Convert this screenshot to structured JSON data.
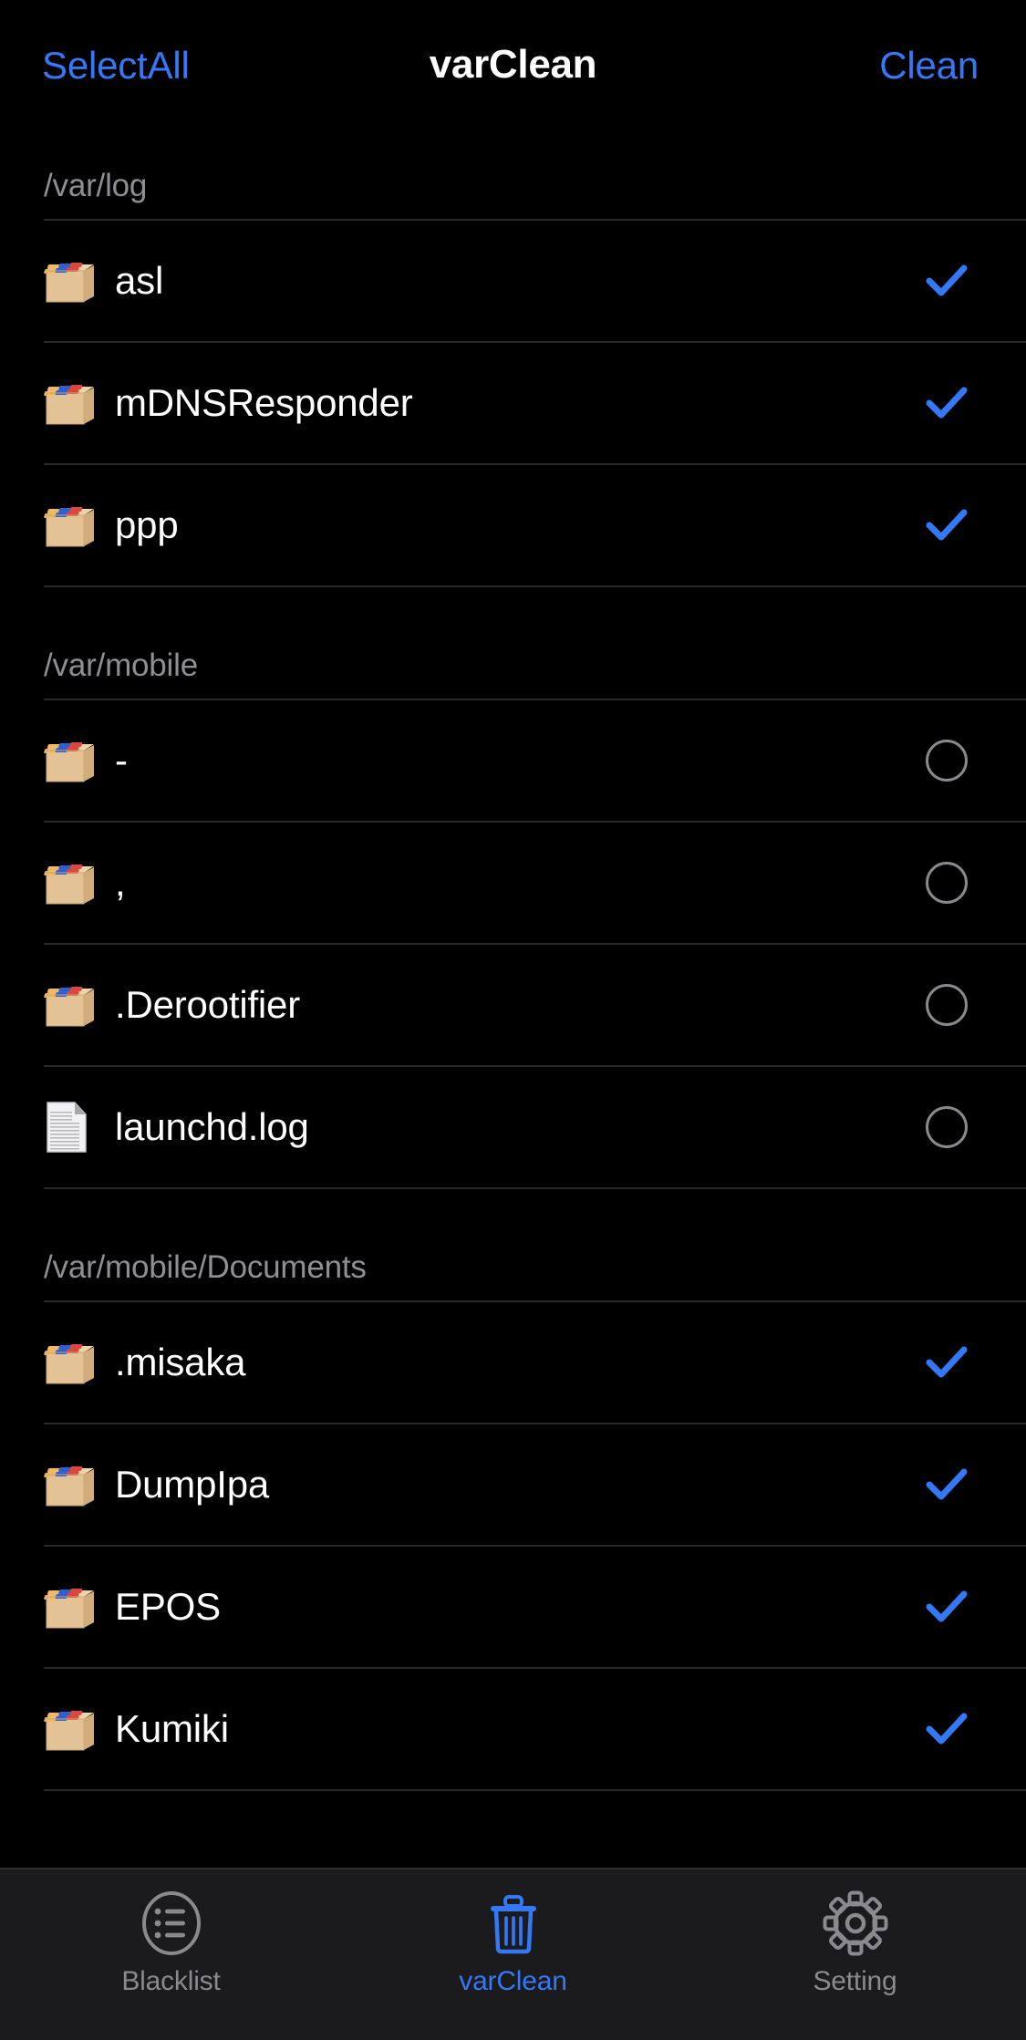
{
  "navbar": {
    "left_button": "SelectAll",
    "title": "varClean",
    "right_button": "Clean"
  },
  "colors": {
    "background": "#000000",
    "accent_blue": "#3478f6",
    "section_header_text": "#8e8e93",
    "row_label_text": "#ffffff",
    "separator": "#2a2a2c",
    "tabbar_background": "#1b1b1d",
    "inactive_tab": "#8a8a8e",
    "unchecked_circle": "#8a8a8e",
    "folder_fill": "#e8c89a"
  },
  "sections": [
    {
      "header": "/var/log",
      "rows": [
        {
          "icon": "folder-icon",
          "label": "asl",
          "accessory": "checkmark-icon",
          "checked": true
        },
        {
          "icon": "folder-icon",
          "label": "mDNSResponder",
          "accessory": "checkmark-icon",
          "checked": true
        },
        {
          "icon": "folder-icon",
          "label": "ppp",
          "accessory": "checkmark-icon",
          "checked": true
        }
      ]
    },
    {
      "header": "/var/mobile",
      "rows": [
        {
          "icon": "folder-icon",
          "label": "-",
          "accessory": "empty-circle-icon",
          "checked": false
        },
        {
          "icon": "folder-icon",
          "label": ",",
          "accessory": "empty-circle-icon",
          "checked": false
        },
        {
          "icon": "folder-icon",
          "label": ".Derootifier",
          "accessory": "empty-circle-icon",
          "checked": false
        },
        {
          "icon": "file-icon",
          "label": "launchd.log",
          "accessory": "empty-circle-icon",
          "checked": false
        }
      ]
    },
    {
      "header": "/var/mobile/Documents",
      "rows": [
        {
          "icon": "folder-icon",
          "label": ".misaka",
          "accessory": "checkmark-icon",
          "checked": true
        },
        {
          "icon": "folder-icon",
          "label": "DumpIpa",
          "accessory": "checkmark-icon",
          "checked": true
        },
        {
          "icon": "folder-icon",
          "label": "EPOS",
          "accessory": "checkmark-icon",
          "checked": true
        },
        {
          "icon": "folder-icon",
          "label": "Kumiki",
          "accessory": "checkmark-icon",
          "checked": true
        }
      ]
    }
  ],
  "tabbar": {
    "tabs": [
      {
        "label": "Blacklist",
        "icon": "circled-list-icon",
        "active": false
      },
      {
        "label": "varClean",
        "icon": "trash-icon",
        "active": true
      },
      {
        "label": "Setting",
        "icon": "gear-icon",
        "active": false
      }
    ]
  }
}
